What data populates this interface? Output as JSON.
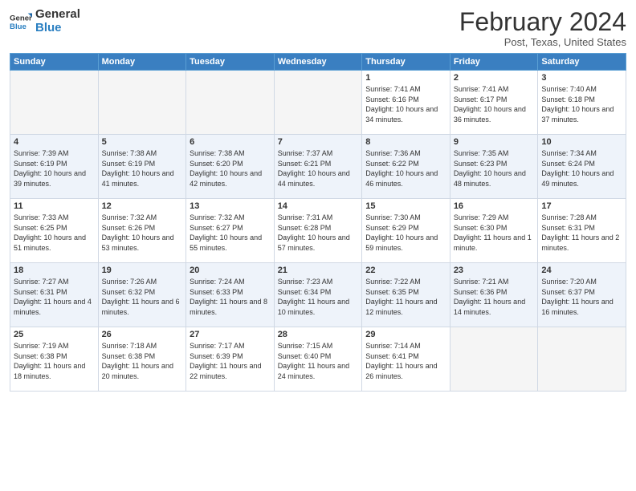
{
  "header": {
    "logo_line1": "General",
    "logo_line2": "Blue",
    "month_year": "February 2024",
    "location": "Post, Texas, United States"
  },
  "weekdays": [
    "Sunday",
    "Monday",
    "Tuesday",
    "Wednesday",
    "Thursday",
    "Friday",
    "Saturday"
  ],
  "weeks": [
    [
      {
        "day": "",
        "empty": true
      },
      {
        "day": "",
        "empty": true
      },
      {
        "day": "",
        "empty": true
      },
      {
        "day": "",
        "empty": true
      },
      {
        "day": "1",
        "sunrise": "7:41 AM",
        "sunset": "6:16 PM",
        "daylight": "10 hours and 34 minutes."
      },
      {
        "day": "2",
        "sunrise": "7:41 AM",
        "sunset": "6:17 PM",
        "daylight": "10 hours and 36 minutes."
      },
      {
        "day": "3",
        "sunrise": "7:40 AM",
        "sunset": "6:18 PM",
        "daylight": "10 hours and 37 minutes."
      }
    ],
    [
      {
        "day": "4",
        "sunrise": "7:39 AM",
        "sunset": "6:19 PM",
        "daylight": "10 hours and 39 minutes."
      },
      {
        "day": "5",
        "sunrise": "7:38 AM",
        "sunset": "6:19 PM",
        "daylight": "10 hours and 41 minutes."
      },
      {
        "day": "6",
        "sunrise": "7:38 AM",
        "sunset": "6:20 PM",
        "daylight": "10 hours and 42 minutes."
      },
      {
        "day": "7",
        "sunrise": "7:37 AM",
        "sunset": "6:21 PM",
        "daylight": "10 hours and 44 minutes."
      },
      {
        "day": "8",
        "sunrise": "7:36 AM",
        "sunset": "6:22 PM",
        "daylight": "10 hours and 46 minutes."
      },
      {
        "day": "9",
        "sunrise": "7:35 AM",
        "sunset": "6:23 PM",
        "daylight": "10 hours and 48 minutes."
      },
      {
        "day": "10",
        "sunrise": "7:34 AM",
        "sunset": "6:24 PM",
        "daylight": "10 hours and 49 minutes."
      }
    ],
    [
      {
        "day": "11",
        "sunrise": "7:33 AM",
        "sunset": "6:25 PM",
        "daylight": "10 hours and 51 minutes."
      },
      {
        "day": "12",
        "sunrise": "7:32 AM",
        "sunset": "6:26 PM",
        "daylight": "10 hours and 53 minutes."
      },
      {
        "day": "13",
        "sunrise": "7:32 AM",
        "sunset": "6:27 PM",
        "daylight": "10 hours and 55 minutes."
      },
      {
        "day": "14",
        "sunrise": "7:31 AM",
        "sunset": "6:28 PM",
        "daylight": "10 hours and 57 minutes."
      },
      {
        "day": "15",
        "sunrise": "7:30 AM",
        "sunset": "6:29 PM",
        "daylight": "10 hours and 59 minutes."
      },
      {
        "day": "16",
        "sunrise": "7:29 AM",
        "sunset": "6:30 PM",
        "daylight": "11 hours and 1 minute."
      },
      {
        "day": "17",
        "sunrise": "7:28 AM",
        "sunset": "6:31 PM",
        "daylight": "11 hours and 2 minutes."
      }
    ],
    [
      {
        "day": "18",
        "sunrise": "7:27 AM",
        "sunset": "6:31 PM",
        "daylight": "11 hours and 4 minutes."
      },
      {
        "day": "19",
        "sunrise": "7:26 AM",
        "sunset": "6:32 PM",
        "daylight": "11 hours and 6 minutes."
      },
      {
        "day": "20",
        "sunrise": "7:24 AM",
        "sunset": "6:33 PM",
        "daylight": "11 hours and 8 minutes."
      },
      {
        "day": "21",
        "sunrise": "7:23 AM",
        "sunset": "6:34 PM",
        "daylight": "11 hours and 10 minutes."
      },
      {
        "day": "22",
        "sunrise": "7:22 AM",
        "sunset": "6:35 PM",
        "daylight": "11 hours and 12 minutes."
      },
      {
        "day": "23",
        "sunrise": "7:21 AM",
        "sunset": "6:36 PM",
        "daylight": "11 hours and 14 minutes."
      },
      {
        "day": "24",
        "sunrise": "7:20 AM",
        "sunset": "6:37 PM",
        "daylight": "11 hours and 16 minutes."
      }
    ],
    [
      {
        "day": "25",
        "sunrise": "7:19 AM",
        "sunset": "6:38 PM",
        "daylight": "11 hours and 18 minutes."
      },
      {
        "day": "26",
        "sunrise": "7:18 AM",
        "sunset": "6:38 PM",
        "daylight": "11 hours and 20 minutes."
      },
      {
        "day": "27",
        "sunrise": "7:17 AM",
        "sunset": "6:39 PM",
        "daylight": "11 hours and 22 minutes."
      },
      {
        "day": "28",
        "sunrise": "7:15 AM",
        "sunset": "6:40 PM",
        "daylight": "11 hours and 24 minutes."
      },
      {
        "day": "29",
        "sunrise": "7:14 AM",
        "sunset": "6:41 PM",
        "daylight": "11 hours and 26 minutes."
      },
      {
        "day": "",
        "empty": true
      },
      {
        "day": "",
        "empty": true
      }
    ]
  ],
  "labels": {
    "sunrise_prefix": "Sunrise: ",
    "sunset_prefix": "Sunset: ",
    "daylight_prefix": "Daylight: "
  }
}
